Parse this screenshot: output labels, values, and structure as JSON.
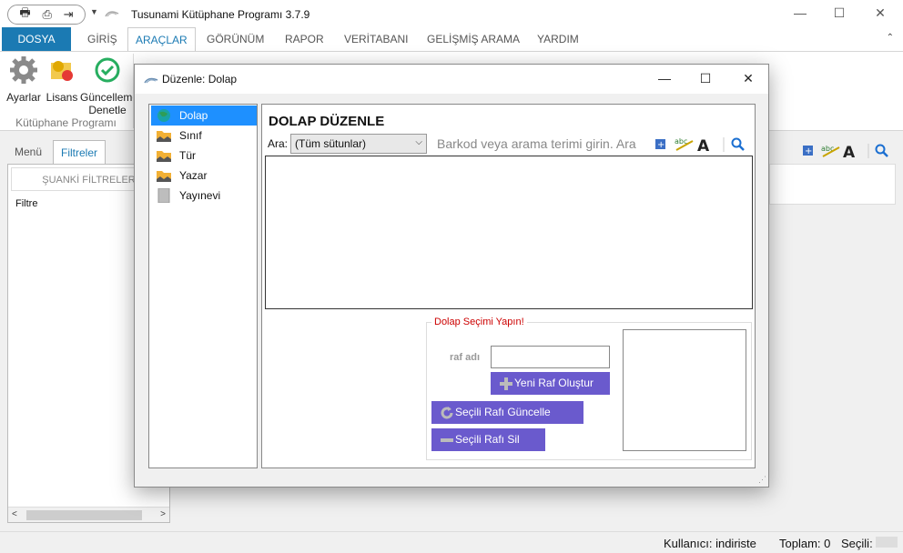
{
  "window": {
    "title": "Tusunami Kütüphane Programı 3.7.9",
    "controls": {
      "minimize": "—",
      "maximize": "☐",
      "close": "✕"
    },
    "quick_access": [
      "🖶",
      "⎙",
      "⇥"
    ]
  },
  "ribbon": {
    "tabs": [
      "DOSYA",
      "GİRİŞ",
      "ARAÇLAR",
      "GÖRÜNÜM",
      "RAPOR",
      "VERİTABANI",
      "GELİŞMİŞ ARAMA",
      "YARDIM"
    ],
    "active_tab": "ARAÇLAR",
    "buttons": [
      {
        "label": "Ayarlar",
        "icon": "gear-icon"
      },
      {
        "label": "Lisans",
        "icon": "license-icon"
      },
      {
        "label": "Güncelleme Denetle",
        "label_line1": "Güncelleme",
        "label_line2": "Denetle",
        "icon": "refresh-check-icon"
      }
    ],
    "group_label": "Kütüphane Programı"
  },
  "left_panel": {
    "tabs": [
      "Menü",
      "Filtreler"
    ],
    "active_tab": "Filtreler",
    "header": "ŞUANKİ FİLTRELER",
    "filter_label": "Filtre"
  },
  "status_bar": {
    "user": "Kullanıcı: indiriste",
    "total": "Toplam: 0",
    "selected": "Seçili:"
  },
  "dialog": {
    "title": "Düzenle: Dolap",
    "nav": [
      {
        "label": "Dolap",
        "icon": "globe-icon",
        "selected": true
      },
      {
        "label": "Sınıf",
        "icon": "folder-icon",
        "selected": false
      },
      {
        "label": "Tür",
        "icon": "folder-icon",
        "selected": false
      },
      {
        "label": "Yazar",
        "icon": "folder-icon",
        "selected": false
      },
      {
        "label": "Yayınevi",
        "icon": "document-icon",
        "selected": false
      }
    ],
    "heading": "DOLAP DÜZENLE",
    "search": {
      "label": "Ara:",
      "column_select": "(Tüm sütunlar)",
      "placeholder": "Barkod veya arama terimi girin. Ara"
    },
    "shelf_section": {
      "legend": "Dolap Seçimi Yapın!",
      "raf_label": "raf adı",
      "raf_value": "",
      "create_button": "Yeni Raf Oluştur",
      "update_button": "Seçili Rafı Güncelle",
      "delete_button": "Seçili Rafı Sil"
    }
  },
  "colors": {
    "file_tab": "#1b7ab3",
    "accent": "#1b7ab3",
    "nav_selected": "#1e90ff",
    "action_button": "#6a5acd",
    "legend_text": "#cc0000"
  }
}
